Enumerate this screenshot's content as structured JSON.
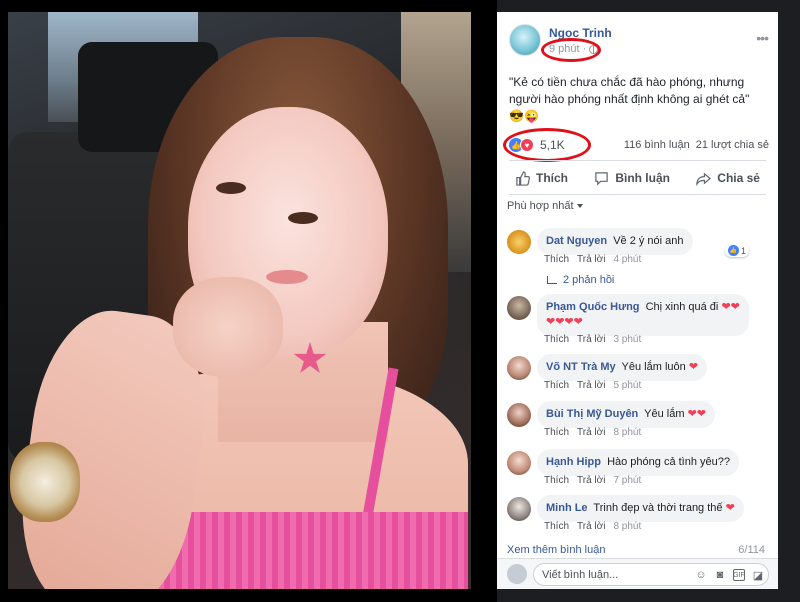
{
  "post": {
    "author": "Ngọc Trinh",
    "time": "9 phút",
    "text": "\"Kẻ có tiền chưa chắc đã hào phóng, nhưng người hào phóng nhất định không ai ghét cả\" 😎😜",
    "reaction_count": "5,1K",
    "comments_count": "116 bình luận",
    "shares_count": "21 lượt chia sẻ",
    "actions": {
      "like": "Thích",
      "comment": "Bình luận",
      "share": "Chia sẻ"
    },
    "filter": "Phù hợp nhất"
  },
  "comments": [
    {
      "name": "Dat Nguyen",
      "text": "Về 2 ý nói anh",
      "hearts": "",
      "hearts2": "",
      "like_label": "Thích",
      "reply_label": "Trả lời",
      "time": "4 phút",
      "reaction_count": "1",
      "replies": "2 phản hồi"
    },
    {
      "name": "Phạm Quốc Hưng",
      "text": "Chị xinh quá đi",
      "hearts": "❤❤",
      "hearts2": "❤❤❤❤",
      "like_label": "Thích",
      "reply_label": "Trả lời",
      "time": "3 phút"
    },
    {
      "name": "Võ NT Trà My",
      "text": "Yêu lắm luôn",
      "hearts": "❤",
      "hearts2": "",
      "like_label": "Thích",
      "reply_label": "Trả lời",
      "time": "5 phút"
    },
    {
      "name": "Bùi Thị Mỹ Duyên",
      "text": "Yêu lắm",
      "hearts": "❤❤",
      "hearts2": "",
      "like_label": "Thích",
      "reply_label": "Trả lời",
      "time": "8 phút"
    },
    {
      "name": "Hạnh Hipp",
      "text": "Hào phóng cả tình yêu??",
      "hearts": "",
      "hearts2": "",
      "like_label": "Thích",
      "reply_label": "Trả lời",
      "time": "7 phút"
    },
    {
      "name": "Minh Le",
      "text": "Trinh đẹp và thời trang thế",
      "hearts": "❤",
      "hearts2": "",
      "like_label": "Thích",
      "reply_label": "Trả lời",
      "time": "8 phút"
    }
  ],
  "more_comments": {
    "label": "Xem thêm bình luận",
    "page": "6/114"
  },
  "composer": {
    "placeholder": "Viết bình luận..."
  },
  "colors": {
    "highlight": "#e0101a",
    "link": "#385898",
    "like": "#4080ff",
    "love": "#f33e58"
  },
  "icons": [
    "globe-icon",
    "more-icon",
    "like-icon",
    "comment-icon",
    "share-icon",
    "emoji-icon",
    "camera-icon",
    "gif-icon",
    "sticker-icon"
  ]
}
